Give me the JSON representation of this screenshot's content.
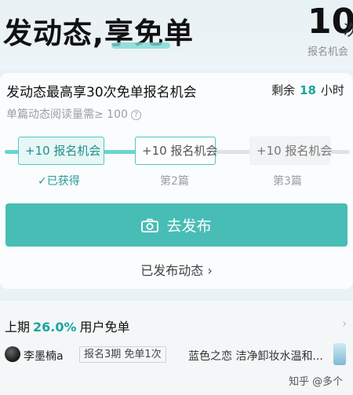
{
  "hero": {
    "title": "发动态,享免单",
    "count": "10",
    "count_unit": "次",
    "count_label": "报名机会"
  },
  "card": {
    "title": "发动态最高享30次免单报名机会",
    "remain_prefix": "剩余",
    "remain_value": "18",
    "remain_unit": "小时",
    "threshold": "单篇动态阅读量需≥ 100",
    "steps": [
      {
        "box": "+10 报名机会",
        "label": "✓已获得"
      },
      {
        "box": "+10 报名机会",
        "label": "第2篇"
      },
      {
        "box": "+10 报名机会",
        "label": "第3篇"
      }
    ],
    "progress_fraction": 0.36,
    "publish_label": "去发布",
    "published_link": "已发布动态 ›"
  },
  "last_period": {
    "prefix": "上期",
    "percent": "26.0%",
    "suffix": "用户免单",
    "user_name": "李墨楠a",
    "user_badge": "报名3期 免单1次",
    "product": "蓝色之恋 洁净卸妆水温和..."
  },
  "watermark": "知乎 @多个",
  "colors": {
    "accent": "#48bdb5",
    "accent_text": "#1aa6a0"
  }
}
